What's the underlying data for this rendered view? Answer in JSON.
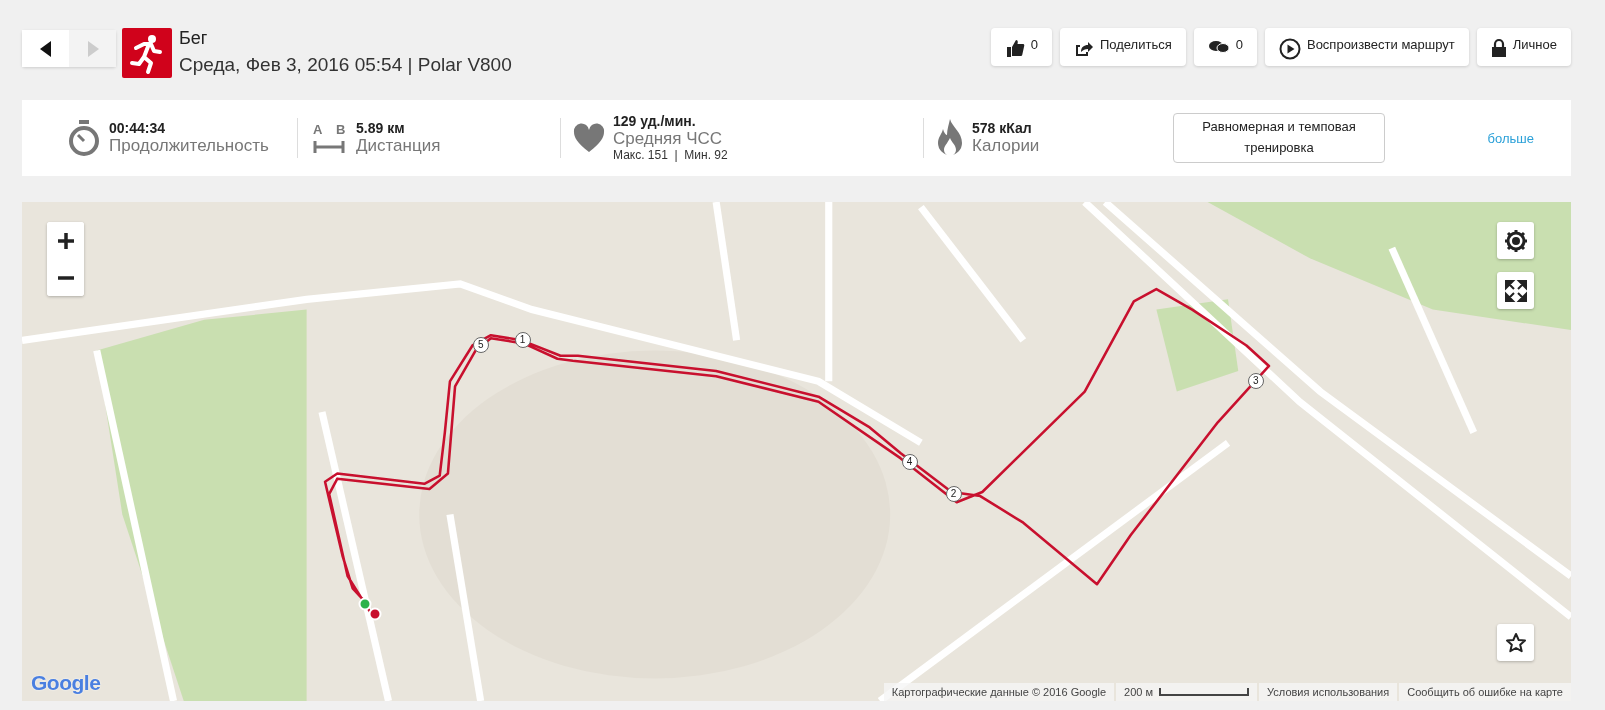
{
  "nav": {
    "back": {
      "disabled": false
    },
    "forward": {
      "disabled": true
    }
  },
  "activity": {
    "sport": "Бег",
    "subtitle": "Среда, Фев 3, 2016 05:54 | Polar V800"
  },
  "actions": [
    {
      "kind": "like",
      "label": "0"
    },
    {
      "kind": "share",
      "label": "Поделиться"
    },
    {
      "kind": "comment",
      "label": "0"
    },
    {
      "kind": "replay",
      "label": "Воспроизвести маршрут"
    },
    {
      "kind": "privacy",
      "label": "Личное"
    }
  ],
  "stats": [
    {
      "kind": "duration",
      "value": "00:44:34",
      "label": "Продолжительность"
    },
    {
      "kind": "distance",
      "value": "5.89 км",
      "label": "Дистанция",
      "icon_letters": [
        "A",
        "B"
      ]
    },
    {
      "kind": "heart_rate",
      "value": "129 уд./мин.",
      "label": "Средняя ЧСС",
      "details": "Макс. 151  |  Мин. 92"
    },
    {
      "kind": "calories",
      "value": "578 кКал",
      "label": "Калории"
    }
  ],
  "training_benefit": "Равномерная и темповая тренировка",
  "more_link": "больше",
  "map": {
    "lap_markers": [
      "1",
      "2",
      "3",
      "4",
      "5"
    ],
    "google_logo": "Google",
    "attribution": "Картографические данные © 2016 Google",
    "scale": "200 м",
    "terms": "Условия использования",
    "report": "Сообщить об ошибке на карте"
  }
}
